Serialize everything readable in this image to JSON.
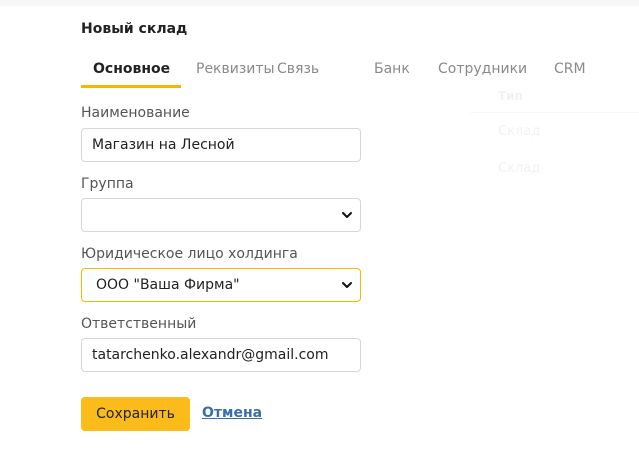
{
  "modal": {
    "title": "Новый склад",
    "tabs": [
      {
        "label": "Основное",
        "active": true
      },
      {
        "label": "Реквизиты",
        "active": false
      },
      {
        "label": "Связь",
        "active": false
      },
      {
        "label": "Банк",
        "active": false
      },
      {
        "label": "Сотрудники",
        "active": false
      },
      {
        "label": "CRM",
        "active": false
      }
    ],
    "fields": {
      "name": {
        "label": "Наименование",
        "value": "Магазин на Лесной"
      },
      "group": {
        "label": "Группа",
        "value": ""
      },
      "legal_entity": {
        "label": "Юридическое лицо холдинга",
        "value": "ООО \"Ваша Фирма\""
      },
      "responsible": {
        "label": "Ответственный",
        "value": "tatarchenko.alexandr@gmail.com"
      }
    },
    "buttons": {
      "save": "Сохранить",
      "cancel": "Отмена"
    }
  },
  "background": {
    "column_header": "Тип",
    "rows": [
      "Склад",
      "Склад"
    ]
  },
  "colors": {
    "accent": "#fbbb1b",
    "tab_underline": "#f5b800",
    "link": "#3b6ea8"
  },
  "icons": {
    "select_arrow": "chevron-down-icon"
  }
}
